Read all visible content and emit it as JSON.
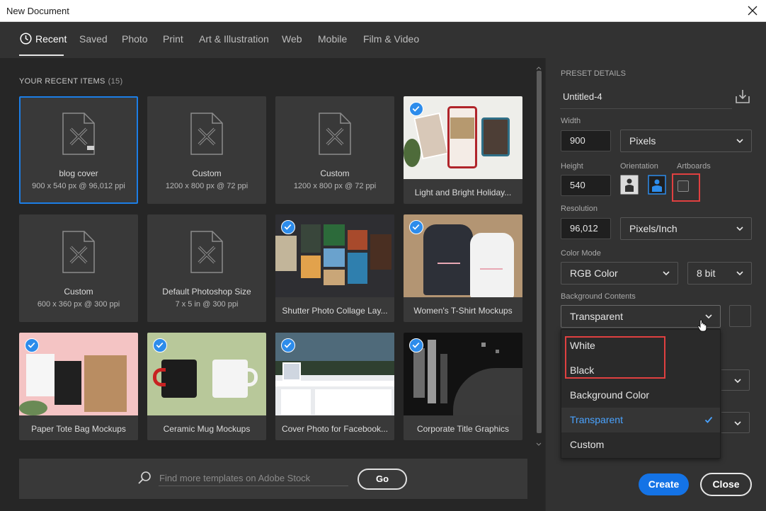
{
  "window": {
    "title": "New Document"
  },
  "tabs": [
    {
      "label": "Recent",
      "active": true
    },
    {
      "label": "Saved"
    },
    {
      "label": "Photo"
    },
    {
      "label": "Print"
    },
    {
      "label": "Art & Illustration"
    },
    {
      "label": "Web"
    },
    {
      "label": "Mobile"
    },
    {
      "label": "Film & Video"
    }
  ],
  "recent": {
    "title": "YOUR RECENT ITEMS",
    "count": "(15)",
    "items": [
      {
        "name": "blog cover",
        "sub": "900 x 540 px @ 96,012 ppi",
        "kind": "doc",
        "selected": true
      },
      {
        "name": "Custom",
        "sub": "1200 x 800 px @ 72 ppi",
        "kind": "doc"
      },
      {
        "name": "Custom",
        "sub": "1200 x 800 px @ 72 ppi",
        "kind": "doc"
      },
      {
        "name": "Light and Bright Holiday...",
        "kind": "template",
        "icon": "holiday-mockup"
      },
      {
        "name": "Custom",
        "sub": "600 x 360 px @ 300 ppi",
        "kind": "doc"
      },
      {
        "name": "Default Photoshop Size",
        "sub": "7 x 5 in @ 300 ppi",
        "kind": "doc"
      },
      {
        "name": "Shutter Photo Collage Lay...",
        "kind": "template",
        "icon": "photo-collage"
      },
      {
        "name": "Women's T-Shirt Mockups",
        "kind": "template",
        "icon": "tshirt-mockup"
      },
      {
        "name": "Paper Tote Bag Mockups",
        "kind": "template",
        "icon": "tote-bag"
      },
      {
        "name": "Ceramic Mug Mockups",
        "kind": "template",
        "icon": "mug-mockup"
      },
      {
        "name": "Cover Photo for Facebook...",
        "kind": "template",
        "icon": "facebook-cover"
      },
      {
        "name": "Corporate Title Graphics",
        "kind": "template",
        "icon": "corporate-title"
      }
    ]
  },
  "stock": {
    "placeholder": "Find more templates on Adobe Stock",
    "go": "Go"
  },
  "preset": {
    "section_label": "PRESET DETAILS",
    "name": "Untitled-4",
    "width_label": "Width",
    "width": "900",
    "width_unit": "Pixels",
    "height_label": "Height",
    "height": "540",
    "orientation_label": "Orientation",
    "artboards_label": "Artboards",
    "resolution_label": "Resolution",
    "resolution": "96,012",
    "resolution_unit": "Pixels/Inch",
    "color_mode_label": "Color Mode",
    "color_mode": "RGB Color",
    "bit_depth": "8 bit",
    "bg_label": "Background Contents",
    "bg_value": "Transparent",
    "bg_options": [
      {
        "label": "White"
      },
      {
        "label": "Black"
      },
      {
        "label": "Background Color"
      },
      {
        "label": "Transparent",
        "active": true
      },
      {
        "label": "Custom"
      }
    ]
  },
  "buttons": {
    "create": "Create",
    "close": "Close"
  },
  "colors": {
    "accent": "#1473e6",
    "highlight": "#e04040",
    "selected_text": "#4aa3ff"
  }
}
